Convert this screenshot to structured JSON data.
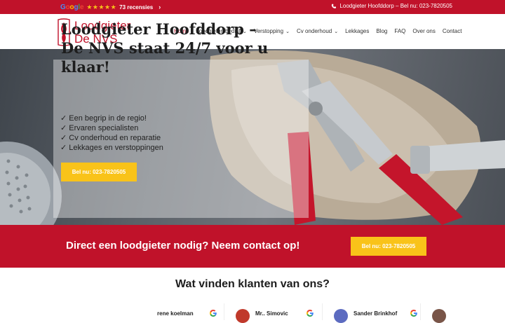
{
  "topbar": {
    "google_word": "Google",
    "stars": "★★★★★",
    "reviews_label": "73 recensies",
    "reviews_chevron": "›",
    "phone_text": "Loodgieter Hoofddorp – Bel nu: 023-7820505",
    "phone_icon": "phone-icon"
  },
  "header": {
    "logo_line1": "Loodgieter",
    "logo_line2": "De NVS",
    "nav": [
      {
        "label": "Home",
        "active": true,
        "dropdown": false
      },
      {
        "label": "Loodgietersbedrijf",
        "active": false,
        "dropdown": true
      },
      {
        "label": "Verstopping",
        "active": false,
        "dropdown": true
      },
      {
        "label": "Cv onderhoud",
        "active": false,
        "dropdown": true
      },
      {
        "label": "Lekkages",
        "active": false,
        "dropdown": false
      },
      {
        "label": "Blog",
        "active": false,
        "dropdown": false
      },
      {
        "label": "FAQ",
        "active": false,
        "dropdown": false
      },
      {
        "label": "Over ons",
        "active": false,
        "dropdown": false
      },
      {
        "label": "Contact",
        "active": false,
        "dropdown": false
      }
    ],
    "dropdown_glyph": "⌄"
  },
  "hero": {
    "title_line1": "Loodgieter Hoofddorp –",
    "title_line2": "De NVS staat 24/7 voor u klaar!",
    "bullets": [
      "✓ Een begrip in de regio!",
      "✓ Ervaren specialisten",
      "✓ Cv onderhoud en reparatie",
      "✓ Lekkages en verstoppingen"
    ],
    "button_label": "Bel nu: 023-7820505"
  },
  "cta": {
    "text": "Direct een loodgieter nodig? Neem contact op!",
    "button_label": "Bel nu: 023-7820505"
  },
  "reviews": {
    "title": "Wat vinden klanten van ons?",
    "items": [
      {
        "name": "rene koelman",
        "avatar_color": ""
      },
      {
        "name": "Mr.. Simovic",
        "avatar_color": "#c0392b"
      },
      {
        "name": "Sander Brinkhof",
        "avatar_color": "#5c6bc0"
      },
      {
        "name": "",
        "avatar_color": "#795548"
      }
    ]
  },
  "colors": {
    "brand_red": "#c0122a",
    "accent_yellow": "#f9c319"
  }
}
